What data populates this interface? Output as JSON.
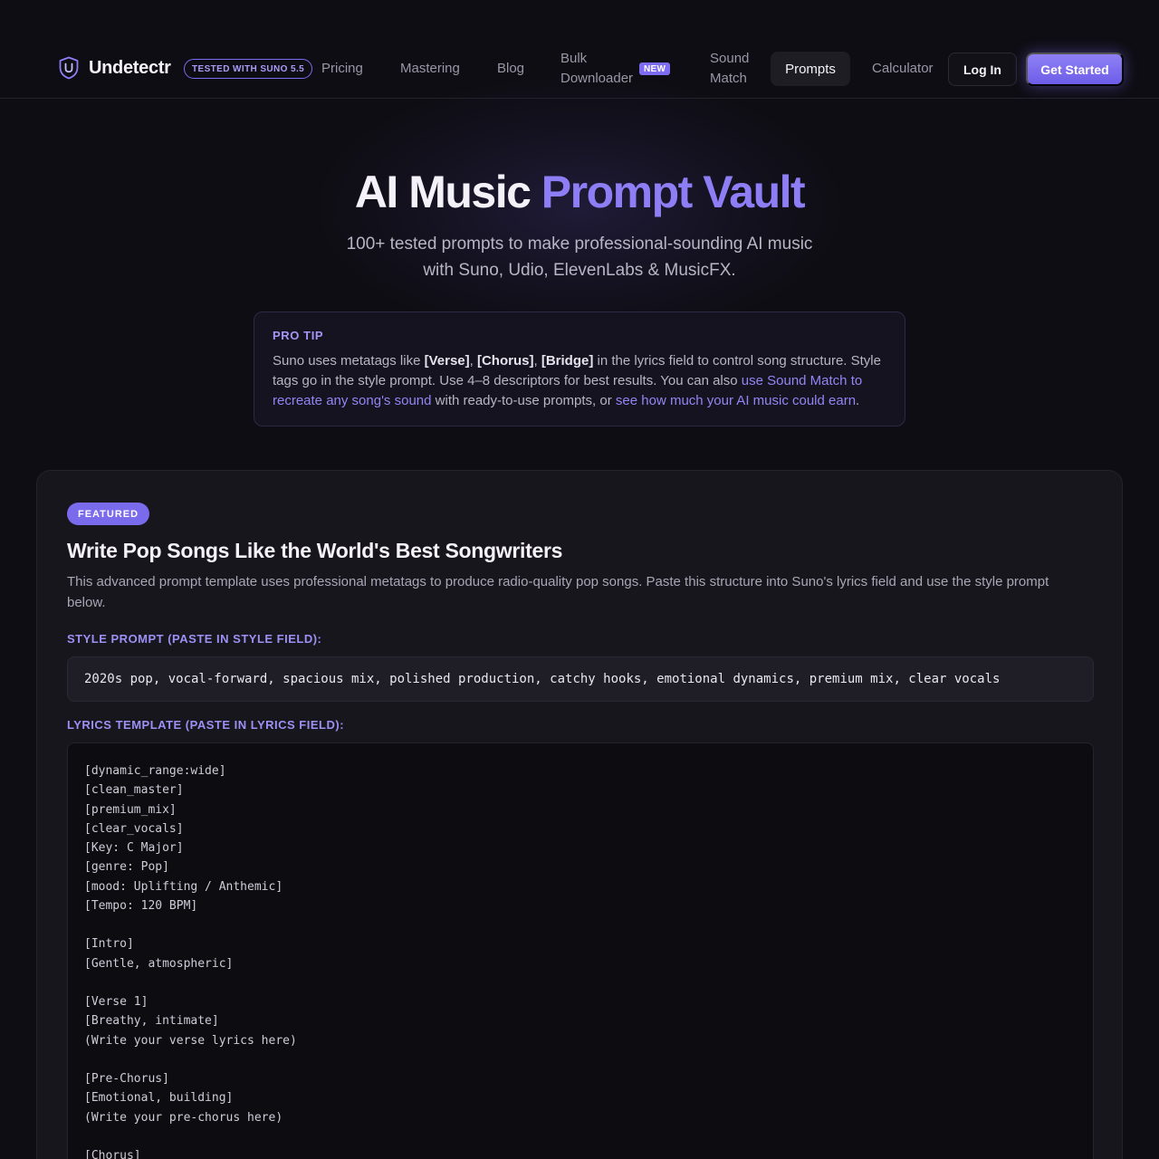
{
  "nav": {
    "brand": "Undetectr",
    "suno_badge": "TESTED WITH SUNO 5.5",
    "links": {
      "pricing": "Pricing",
      "mastering": "Mastering",
      "blog": "Blog",
      "bulk_line1": "Bulk",
      "bulk_line2": "Downloader",
      "new_badge": "NEW",
      "sound_line1": "Sound",
      "sound_line2": "Match",
      "prompts": "Prompts",
      "calculator": "Calculator"
    },
    "login": "Log In",
    "get_started": "Get Started",
    "logo_icon": "shield-u-icon"
  },
  "hero": {
    "title_main": "AI Music ",
    "title_accent": "Prompt Vault",
    "subtitle_line1": "100+ tested prompts to make professional-sounding AI music",
    "subtitle_line2": "with Suno, Udio, ElevenLabs & MusicFX."
  },
  "tip": {
    "label": "PRO TIP",
    "t1": "Suno uses metatags like ",
    "verse": "[Verse]",
    "sep1": ", ",
    "chorus": "[Chorus]",
    "sep2": ", ",
    "bridge": "[Bridge]",
    "t2": " in the lyrics field to control song structure. Style tags go in the style prompt. Use 4–8 descriptors for best results. You can also ",
    "link1": "use Sound Match to recreate any song's sound",
    "t3": " with ready-to-use prompts, or ",
    "link2": "see how much your AI music could earn",
    "t4": "."
  },
  "featured": {
    "badge": "FEATURED",
    "title": "Write Pop Songs Like the World's Best Songwriters",
    "description": "This advanced prompt template uses professional metatags to produce radio-quality pop songs. Paste this structure into Suno's lyrics field and use the style prompt below.",
    "style_label": "STYLE PROMPT (PASTE IN STYLE FIELD):",
    "style_prompt": "2020s pop, vocal-forward, spacious mix, polished production, catchy hooks, emotional dynamics, premium mix, clear vocals",
    "lyrics_label": "LYRICS TEMPLATE (PASTE IN LYRICS FIELD):",
    "lyrics": [
      "[dynamic_range:wide]",
      "[clean_master]",
      "[premium_mix]",
      "[clear_vocals]",
      "[Key: C Major]",
      "[genre: Pop]",
      "[mood: Uplifting / Anthemic]",
      "[Tempo: 120 BPM]",
      "",
      "[Intro]",
      "[Gentle, atmospheric]",
      "",
      "[Verse 1]",
      "[Breathy, intimate]",
      "(Write your verse lyrics here)",
      "",
      "[Pre-Chorus]",
      "[Emotional, building]",
      "(Write your pre-chorus here)",
      "",
      "[Chorus]"
    ]
  },
  "colors": {
    "accent": "#8d7ef5",
    "background": "#0e0d13",
    "card": "#17161c"
  }
}
